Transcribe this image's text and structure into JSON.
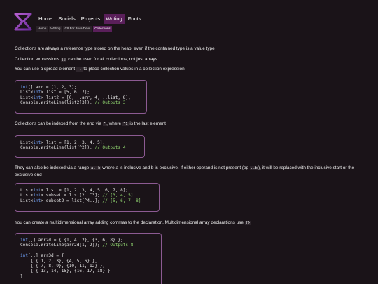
{
  "nav": {
    "items": [
      {
        "label": "Home"
      },
      {
        "label": "Socials"
      },
      {
        "label": "Projects"
      },
      {
        "label": "Writing"
      },
      {
        "label": "Fonts"
      }
    ]
  },
  "breadcrumb": {
    "items": [
      {
        "label": "Home"
      },
      {
        "label": "Writing"
      },
      {
        "label": "C# For Java Devs"
      },
      {
        "label": "Collections"
      }
    ]
  },
  "content": {
    "p1": "Collections are always a reference type stored on the heap, even if the contained type is a value type",
    "p2_before": "Collection expressions ",
    "p2_code": "[]",
    "p2_after": " can be used for all collections, not just arrays",
    "p3_before": "You can use a spread element ",
    "p3_code": "..",
    "p3_after": " to place collection values in a collection expression",
    "p4_before": "Collections can be indexed from the end via ",
    "p4_code1": "^",
    "p4_mid": ", where ",
    "p4_code2": "^1",
    "p4_after": " is the last element",
    "p5_before": "They can also be indexed via a range ",
    "p5_code1": "a..b",
    "p5_mid1": " where a is inclusive and b is exclusive. If either operand is not present (eg ",
    "p5_code2": "..b",
    "p5_after": "), it will be replaced with the inclusive start or the exclusive end",
    "p6_before": "You can create a multidimensional array adding commas to the declaration. Multidimensional array declarations use ",
    "p6_code": "{}"
  },
  "code_blocks": {
    "block1": {
      "l1_kw": "int",
      "l1": "[] arr = [1, 2, 3];",
      "l2_a": "List<",
      "l2_kw": "int",
      "l2_b": "> list = [5, 6, 7];",
      "l3_a": "List<",
      "l3_kw": "int",
      "l3_b": "> list2 = [0, ..arr, 4, ..list, 8];",
      "l4": "Console.WriteLine(list2[3]); ",
      "l4_cm": "// Outputs 3"
    },
    "block2": {
      "l1_a": "List<",
      "l1_kw": "int",
      "l1_b": "> list = [1, 2, 3, 4, 5];",
      "l2": "Console.WriteLine(list[^2]); ",
      "l2_cm": "// Outputs 4"
    },
    "block3": {
      "l1_a": "List<",
      "l1_kw": "int",
      "l1_b": "> list = [1, 2, 3, 4, 5, 6, 7, 8];",
      "l2_a": "List<",
      "l2_kw": "int",
      "l2_b": "> subset = list[2..^3]; ",
      "l2_cm": "// [3, 4, 5]",
      "l3_a": "List<",
      "l3_kw": "int",
      "l3_b": "> subset2 = list[^4..]; ",
      "l3_cm": "// [5, 6, 7, 8]"
    },
    "block4": {
      "l1_kw": "int",
      "l1": "[,] arr2d = { {1, 4, 2}, {3, 6, 8} };",
      "l2": "Console.WriteLine(arr2d[1, 2]); ",
      "l2_cm": "// Outputs 8",
      "l4_kw": "int",
      "l4": "[,,] arr3d = {",
      "l5": "    { { 1, 2, 3}, {4, 5, 6} },",
      "l6": "    { { 7, 8, 9}, {10, 11, 12} },",
      "l7": "    { { 13, 14, 15}, {16, 17, 18} }",
      "l8": "};"
    }
  }
}
